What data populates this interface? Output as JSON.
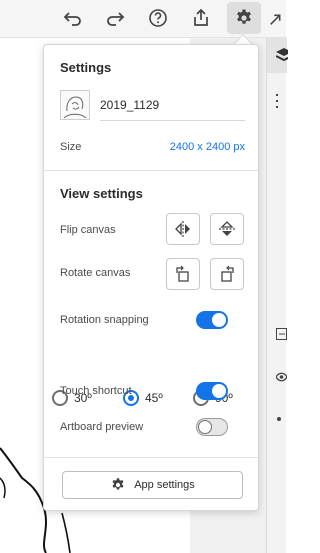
{
  "toolbar": {
    "icons": [
      "undo-icon",
      "redo-icon",
      "help-icon",
      "share-icon",
      "gear-icon"
    ]
  },
  "settings": {
    "title": "Settings",
    "document_name": "2019_1129",
    "size_label": "Size",
    "size_value": "2400 x 2400 px"
  },
  "view_settings": {
    "title": "View settings",
    "flip_label": "Flip canvas",
    "rotate_label": "Rotate canvas",
    "rotation_snapping_label": "Rotation snapping",
    "rotation_snapping_on": true,
    "snap_options": [
      "30º",
      "45º",
      "90º"
    ],
    "snap_selected": "45º",
    "touch_shortcut_label": "Touch shortcut",
    "touch_shortcut_on": true,
    "artboard_preview_label": "Artboard preview",
    "artboard_preview_on": false
  },
  "footer": {
    "app_settings_label": "App settings"
  },
  "colors": {
    "accent": "#1473e6",
    "panel_bg": "#ffffff",
    "toolbar_bg": "#f5f5f5"
  }
}
